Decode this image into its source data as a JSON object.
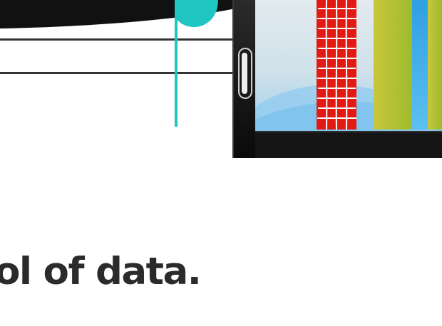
{
  "headline": "ol of data.",
  "colors": {
    "teal": "#1ec5c1",
    "dark": "#111111",
    "text": "#2b2b2b",
    "red": "#e21a12",
    "olive": "#b6c43a",
    "sky": "#3ba8e6"
  }
}
